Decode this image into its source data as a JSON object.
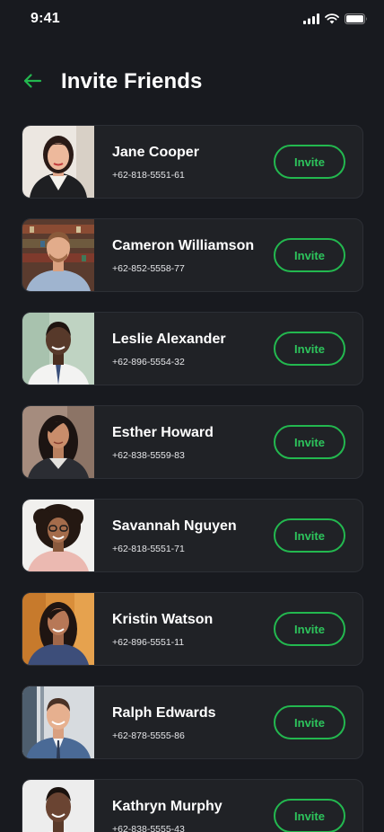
{
  "status_bar": {
    "time": "9:41",
    "icons": [
      "cellular-signal-icon",
      "wifi-icon",
      "battery-icon"
    ]
  },
  "header": {
    "back_icon": "arrow-left-icon",
    "title": "Invite Friends"
  },
  "colors": {
    "background": "#181A1F",
    "card": "#202226",
    "accent": "#23B84F"
  },
  "friends": [
    {
      "name": "Jane Cooper",
      "phone": "+62-818-5551-61",
      "invite_label": "Invite"
    },
    {
      "name": "Cameron Williamson",
      "phone": "+62-852-5558-77",
      "invite_label": "Invite"
    },
    {
      "name": "Leslie Alexander",
      "phone": "+62-896-5554-32",
      "invite_label": "Invite"
    },
    {
      "name": "Esther Howard",
      "phone": "+62-838-5559-83",
      "invite_label": "Invite"
    },
    {
      "name": "Savannah Nguyen",
      "phone": "+62-818-5551-71",
      "invite_label": "Invite"
    },
    {
      "name": "Kristin Watson",
      "phone": "+62-896-5551-11",
      "invite_label": "Invite"
    },
    {
      "name": "Ralph Edwards",
      "phone": "+62-878-5555-86",
      "invite_label": "Invite"
    },
    {
      "name": "Kathryn Murphy",
      "phone": "+62-838-5555-43",
      "invite_label": "Invite"
    }
  ]
}
